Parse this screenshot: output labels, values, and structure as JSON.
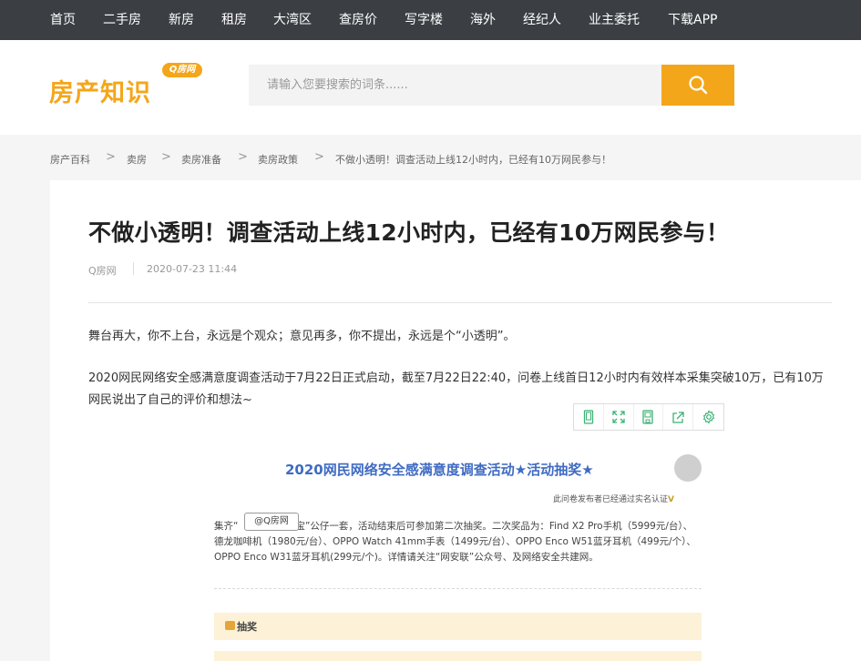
{
  "nav": {
    "items": [
      "首页",
      "二手房",
      "新房",
      "租房",
      "大湾区",
      "查房价",
      "写字楼",
      "海外",
      "经纪人",
      "业主委托",
      "下载APP"
    ]
  },
  "header": {
    "logo": "房产知识",
    "badge": "Q房网",
    "search_placeholder": "请输入您要搜索的词条......",
    "search_icon": "search-icon"
  },
  "breadcrumb": {
    "items": [
      "房产百科",
      "卖房",
      "卖房准备",
      "卖房政策",
      "不做小透明！调查活动上线12小时内，已经有10万网民参与！"
    ],
    "separator": ">"
  },
  "article": {
    "title": "不做小透明！调查活动上线12小时内，已经有10万网民参与！",
    "source": "Q房网",
    "date": "2020-07-23 11:44",
    "paragraphs": [
      "舞台再大，你不上台，永远是个观众；意见再多，你不提出，永远是个“小透明”。",
      "2020网民网络安全感满意度调查活动于7月22日正式启动，截至7月22日22:40，问卷上线首日12小时内有效样本采集突破10万，已有10万网民说出了自己的评价和想法~"
    ]
  },
  "toolbar": {
    "icons": [
      "phone-icon",
      "fullscreen-icon",
      "save-icon",
      "share-icon",
      "settings-icon"
    ]
  },
  "poster": {
    "title": "2020网民网络安全感满意度调查活动★活动抽奖★",
    "cert": "此问卷发布者已经通过实名认证",
    "cert_mark": "V",
    "text_prefix": "集齐“",
    "text": "络四宝”公仔一套，活动结束后可参加第二次抽奖。二次奖品为：Find X2 Pro手机（5999元/台）、德龙咖啡机（1980元/台）、OPPO Watch 41mm手表（1499元/台）、OPPO Enco W51蓝牙耳机（499元/个）、OPPO Enco W31蓝牙耳机(299元/个)。详情请关注“网安联”公众号、及网络安全共建网。",
    "watermark": "@Q房网",
    "prize_label": "抽奖"
  },
  "colors": {
    "nav_bg": "#3b3f44",
    "accent": "#f4a61a",
    "poster_title": "#3f6bc2"
  }
}
